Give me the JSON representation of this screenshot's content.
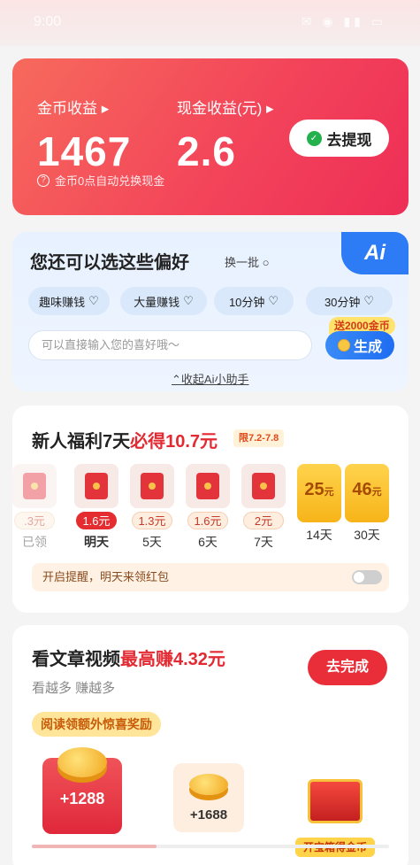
{
  "status": {
    "time": "9:00",
    "icons": "✉ ◉ ▮▮ ▭"
  },
  "earnings": {
    "coin_label": "金币收益",
    "coin_value": "1467",
    "cash_label": "现金收益(元)",
    "cash_value": "2.6",
    "note": "金币0点自动兑换现金",
    "withdraw_label": "去提现",
    "colors": {
      "card": "#f3455a",
      "wechat": "#23b14d"
    }
  },
  "preferences": {
    "title": "您还可以选这些偏好",
    "refresh_label": "换一批",
    "ai_badge": "Ai",
    "chips": [
      "趣味赚钱",
      "大量赚钱",
      "10分钟",
      "30分钟"
    ],
    "input_placeholder": "可以直接输入您的喜好哦～",
    "bonus_tag": "送2000金币",
    "generate_label": "生成",
    "collapse_label": "收起Ai小助手"
  },
  "newbie": {
    "title_prefix": "新人福利7天",
    "title_highlight": "必得10.7元",
    "limit_tag": "限7.2-7.8",
    "days": [
      {
        "amount": ".3元",
        "label": "已领"
      },
      {
        "amount": "1.6元",
        "label": "明天"
      },
      {
        "amount": "1.3元",
        "label": "5天"
      },
      {
        "amount": "1.6元",
        "label": "6天"
      },
      {
        "amount": "2元",
        "label": "7天"
      },
      {
        "amount": "25",
        "unit": "元",
        "label": "14天"
      },
      {
        "amount": "46",
        "unit": "元",
        "label": "30天"
      }
    ],
    "remind_text": "开启提醒，明天来领红包",
    "remind_enabled": false
  },
  "articles": {
    "title_prefix": "看文章视频",
    "title_highlight": "最高赚4.32元",
    "subtitle": "看越多 赚越多",
    "go_label": "去完成",
    "extra_tag": "阅读领额外惊喜奖励",
    "rewards": [
      "+1288",
      "+1688"
    ],
    "chest_label": "开宝箱得金币",
    "progress": 0.35
  }
}
